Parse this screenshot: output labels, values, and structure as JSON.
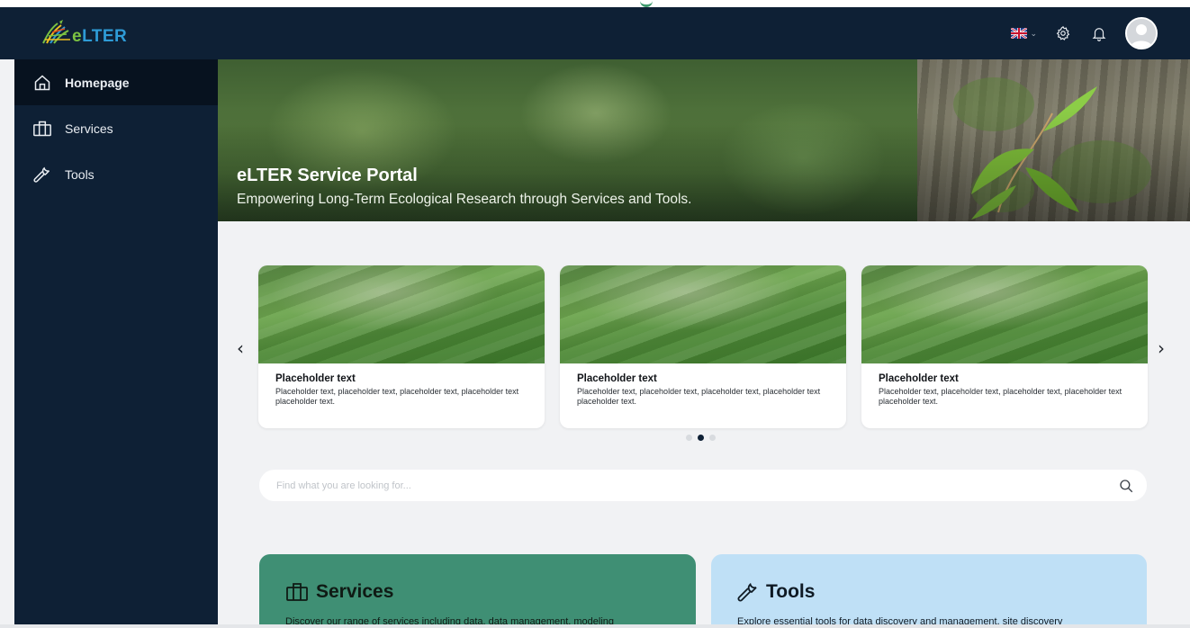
{
  "app": {
    "logo_text_e": "e",
    "logo_text_rest": "LTER",
    "logo_name": "elter-logo"
  },
  "header": {
    "language": "en-GB",
    "icons": [
      "uk-flag-icon",
      "chevron-down-icon",
      "settings-icon",
      "bell-icon",
      "avatar"
    ]
  },
  "sidebar": {
    "items": [
      {
        "label": "Homepage",
        "icon": "home-icon",
        "active": true
      },
      {
        "label": "Services",
        "icon": "services-icon",
        "active": false
      },
      {
        "label": "Tools",
        "icon": "wrench-icon",
        "active": false
      }
    ]
  },
  "hero": {
    "title": "eLTER Service Portal",
    "subtitle": "Empowering Long-Term Ecological Research through Services and Tools."
  },
  "carousel": {
    "prev_label": "‹",
    "next_label": "›",
    "cards": [
      {
        "title": "Placeholder text",
        "text": "Placeholder text, placeholder text, placeholder text, placeholder text placeholder text."
      },
      {
        "title": "Placeholder text",
        "text": "Placeholder text, placeholder text, placeholder text, placeholder text placeholder text."
      },
      {
        "title": "Placeholder text",
        "text": "Placeholder text, placeholder text, placeholder text, placeholder text placeholder text."
      }
    ],
    "dots": 3,
    "active_dot": 1
  },
  "search": {
    "placeholder": "Find what you are looking for..."
  },
  "panels": {
    "services": {
      "title": "Services",
      "text": "Discover our range of services including data, data management, modeling"
    },
    "tools": {
      "title": "Tools",
      "text": "Explore essential tools for data discovery and management, site discovery"
    }
  },
  "colors": {
    "nav_bg": "#0e2035",
    "services_panel": "#3f8f74",
    "tools_panel": "#bfe0f6",
    "logo_green": "#7cc242",
    "logo_blue": "#2e9bd6"
  }
}
